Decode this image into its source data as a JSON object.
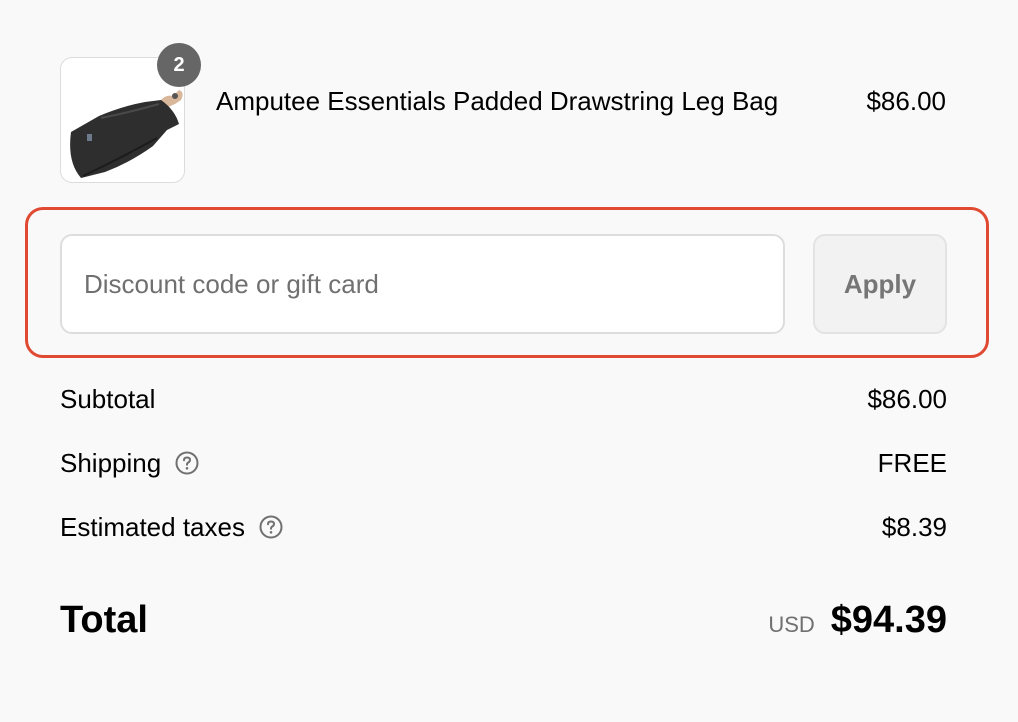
{
  "product": {
    "name": "Amputee Essentials Padded Drawstring Leg Bag",
    "price": "$86.00",
    "quantity": "2",
    "image_icon": "leg-bag-thumbnail"
  },
  "discount": {
    "placeholder": "Discount code or gift card",
    "value": "",
    "apply_label": "Apply",
    "highlight_color": "#e04a33"
  },
  "summary": {
    "subtotal_label": "Subtotal",
    "subtotal_value": "$86.00",
    "shipping_label": "Shipping",
    "shipping_value": "FREE",
    "taxes_label": "Estimated taxes",
    "taxes_value": "$8.39",
    "help_icon": "question-circle-icon"
  },
  "total": {
    "label": "Total",
    "currency": "USD",
    "amount": "$94.39"
  }
}
